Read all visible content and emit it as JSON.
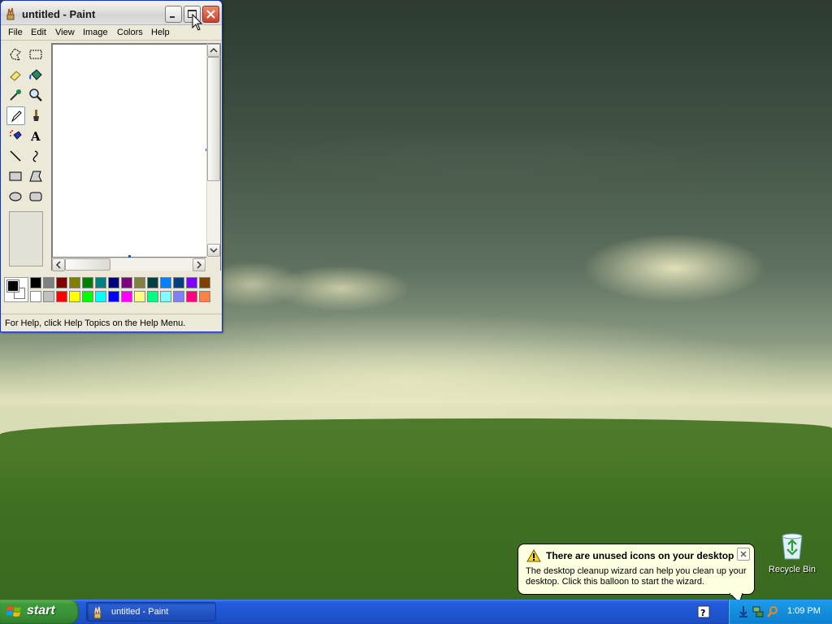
{
  "paint": {
    "title": "untitled - Paint",
    "menu": [
      "File",
      "Edit",
      "View",
      "Image",
      "Colors",
      "Help"
    ],
    "tools": [
      "free-form-select",
      "select",
      "eraser",
      "fill-with-color",
      "pick-color",
      "magnifier",
      "pencil",
      "brush",
      "airbrush",
      "text",
      "line",
      "curve",
      "rectangle",
      "polygon",
      "ellipse",
      "rounded-rectangle"
    ],
    "selected_tool": "pencil",
    "palette_top": [
      "#000000",
      "#808080",
      "#800000",
      "#808000",
      "#008000",
      "#008080",
      "#000080",
      "#800080",
      "#808040",
      "#004040",
      "#0080ff",
      "#004080",
      "#8000ff",
      "#804000"
    ],
    "palette_bottom": [
      "#ffffff",
      "#c0c0c0",
      "#ff0000",
      "#ffff00",
      "#00ff00",
      "#00ffff",
      "#0000ff",
      "#ff00ff",
      "#ffff80",
      "#00ff80",
      "#80ffff",
      "#8080ff",
      "#ff0080",
      "#ff8040"
    ],
    "foreground_color": "#000000",
    "background_color": "#ffffff",
    "status": "For Help, click Help Topics on the Help Menu."
  },
  "desktop": {
    "recycle_bin_label": "Recycle Bin"
  },
  "balloon": {
    "title": "There are unused icons on your desktop",
    "body": "The desktop cleanup wizard can help you clean up your desktop. Click this balloon to start the wizard."
  },
  "taskbar": {
    "start_label": "start",
    "task_label": "untitled - Paint",
    "clock": "1:09 PM"
  }
}
